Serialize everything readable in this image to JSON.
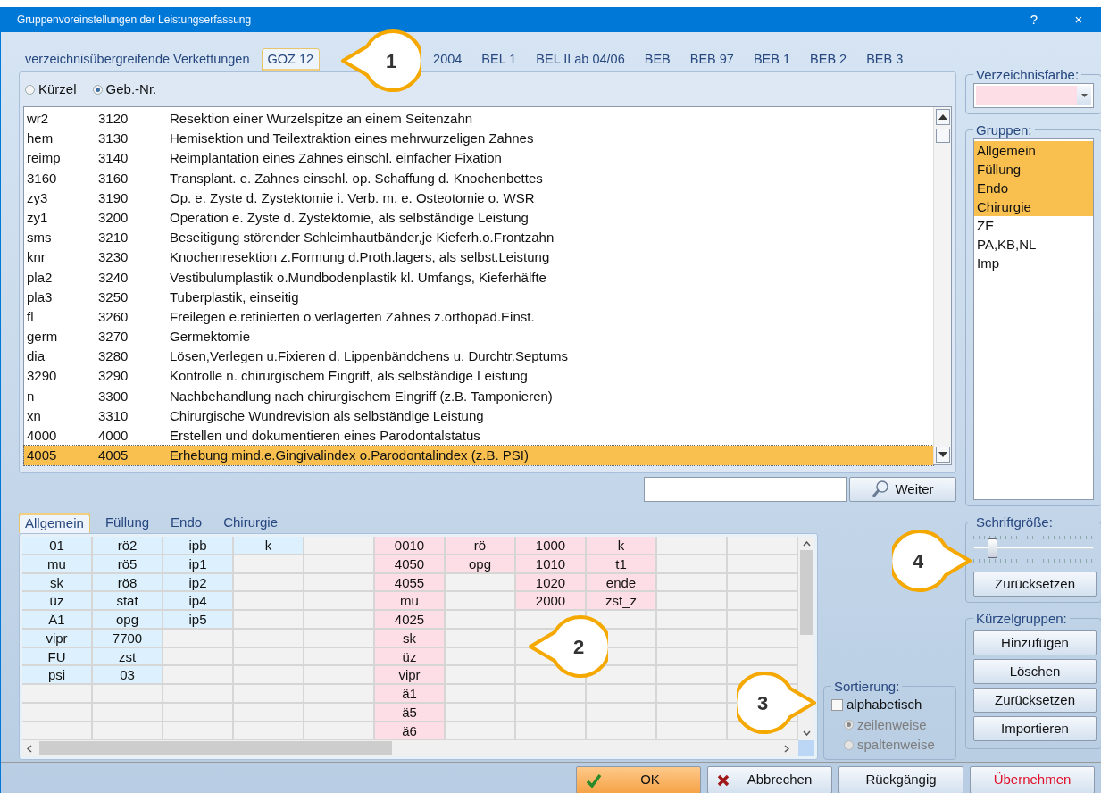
{
  "window": {
    "title": "Gruppenvoreinstellungen der Leistungserfassung",
    "help": "?",
    "close": "×"
  },
  "catalog_tabs": [
    {
      "label": "verzeichnisübergreifende Verkettungen",
      "selected": false
    },
    {
      "label": "GOZ 12",
      "selected": true
    },
    {
      "label": "2004",
      "selected": false
    },
    {
      "label": "BEL 1",
      "selected": false
    },
    {
      "label": "BEL II ab 04/06",
      "selected": false
    },
    {
      "label": "BEB",
      "selected": false
    },
    {
      "label": "BEB 97",
      "selected": false
    },
    {
      "label": "BEB 1",
      "selected": false
    },
    {
      "label": "BEB 2",
      "selected": false
    },
    {
      "label": "BEB 3",
      "selected": false
    }
  ],
  "sort_radios": [
    {
      "label": "Kürzel",
      "selected": false
    },
    {
      "label": "Geb.-Nr.",
      "selected": true
    }
  ],
  "services": [
    {
      "code": "wr2",
      "number": "3120",
      "description": "Resektion einer Wurzelspitze an einem Seitenzahn",
      "selected": false
    },
    {
      "code": "hem",
      "number": "3130",
      "description": "Hemisektion und Teilextraktion eines mehrwurzeligen Zahnes",
      "selected": false
    },
    {
      "code": "reimp",
      "number": "3140",
      "description": "Reimplantation eines Zahnes einschl. einfacher Fixation",
      "selected": false
    },
    {
      "code": "3160",
      "number": "3160",
      "description": "Transplant. e. Zahnes einschl. op. Schaffung d. Knochenbettes",
      "selected": false
    },
    {
      "code": "zy3",
      "number": "3190",
      "description": "Op. e. Zyste d. Zystektomie i. Verb. m. e. Osteotomie o. WSR",
      "selected": false
    },
    {
      "code": "zy1",
      "number": "3200",
      "description": "Operation e. Zyste d. Zystektomie, als selbständige Leistung",
      "selected": false
    },
    {
      "code": "sms",
      "number": "3210",
      "description": "Beseitigung störender Schleimhautbänder,je Kieferh.o.Frontzahn",
      "selected": false
    },
    {
      "code": "knr",
      "number": "3230",
      "description": "Knochenresektion z.Formung d.Proth.lagers, als selbst.Leistung",
      "selected": false
    },
    {
      "code": "pla2",
      "number": "3240",
      "description": "Vestibulumplastik o.Mundbodenplastik kl. Umfangs, Kieferhälfte",
      "selected": false
    },
    {
      "code": "pla3",
      "number": "3250",
      "description": "Tuberplastik, einseitig",
      "selected": false
    },
    {
      "code": "fl",
      "number": "3260",
      "description": "Freilegen e.retinierten o.verlagerten Zahnes z.orthopäd.Einst.",
      "selected": false
    },
    {
      "code": "germ",
      "number": "3270",
      "description": "Germektomie",
      "selected": false
    },
    {
      "code": "dia",
      "number": "3280",
      "description": "Lösen,Verlegen u.Fixieren d. Lippenbändchens u. Durchtr.Septums",
      "selected": false
    },
    {
      "code": "3290",
      "number": "3290",
      "description": "Kontrolle n. chirurgischem Eingriff, als selbständige Leistung",
      "selected": false
    },
    {
      "code": "n",
      "number": "3300",
      "description": "Nachbehandlung nach chirurgischem Eingriff (z.B. Tamponieren)",
      "selected": false
    },
    {
      "code": "xn",
      "number": "3310",
      "description": "Chirurgische Wundrevision  als selbständige Leistung",
      "selected": false
    },
    {
      "code": "4000",
      "number": "4000",
      "description": "Erstellen und dokumentieren eines Parodontalstatus",
      "selected": false
    },
    {
      "code": "4005",
      "number": "4005",
      "description": "Erhebung mind.e.Gingivalindex o.Parodontalindex (z.B. PSI)",
      "selected": true
    }
  ],
  "search_button": "Weiter",
  "group_tabs": [
    {
      "label": "Allgemein",
      "selected": true
    },
    {
      "label": "Füllung",
      "selected": false
    },
    {
      "label": "Endo",
      "selected": false
    },
    {
      "label": "Chirurgie",
      "selected": false
    }
  ],
  "grid_columns": [
    {
      "color": "#dcf1fd",
      "cells": [
        "01",
        "mu",
        "sk",
        "üz",
        "Ä1",
        "vipr",
        "FU",
        "psi"
      ]
    },
    {
      "color": "#dcf1fd",
      "cells": [
        "rö2",
        "rö5",
        "rö8",
        "stat",
        "opg",
        "7700",
        "zst",
        "03"
      ]
    },
    {
      "color": "#dcf1fd",
      "cells": [
        "ipb",
        "ip1",
        "ip2",
        "ip4",
        "ip5"
      ]
    },
    {
      "color": "#dcf1fd",
      "cells": [
        "k"
      ]
    },
    {},
    {
      "color": "#fddde6",
      "cells": [
        "0010",
        "4050",
        "4055",
        "mu",
        "4025",
        "sk",
        "üz",
        "vipr",
        "ä1",
        "ä5",
        "ä6"
      ]
    },
    {
      "color": "#fddde6",
      "cells": [
        "rö",
        "opg"
      ]
    },
    {
      "color": "#fddde6",
      "cells": [
        "1000",
        "1010",
        "1020",
        "2000"
      ]
    },
    {
      "color": "#fddde6",
      "cells": [
        "k",
        "t1",
        "ende",
        "zst_z"
      ]
    },
    {},
    {}
  ],
  "sorting": {
    "title": "Sortierung:",
    "alphabetic": {
      "label": "alphabetisch",
      "checked": false
    },
    "options": [
      {
        "label": "zeilenweise",
        "selected": true,
        "disabled": true
      },
      {
        "label": "spaltenweise",
        "selected": false,
        "disabled": true
      }
    ]
  },
  "catalog_color": {
    "title": "Verzeichnisfarbe:",
    "color": "#fddde6"
  },
  "groups": {
    "title": "Gruppen:",
    "items": [
      {
        "label": "Allgemein",
        "selected": true
      },
      {
        "label": "Füllung",
        "selected": true
      },
      {
        "label": "Endo",
        "selected": true
      },
      {
        "label": "Chirurgie",
        "selected": true
      },
      {
        "label": "ZE",
        "selected": false
      },
      {
        "label": "PA,KB,NL",
        "selected": false
      },
      {
        "label": "Imp",
        "selected": false
      }
    ]
  },
  "font_size": {
    "title": "Schriftgröße:",
    "level": 0.12,
    "reset": "Zurücksetzen"
  },
  "shortcut_groups": {
    "title": "Kürzelgruppen:",
    "buttons": [
      "Hinzufügen",
      "Löschen",
      "Zurücksetzen",
      "Importieren"
    ]
  },
  "footer_buttons": [
    {
      "label": "OK",
      "kind": "ok"
    },
    {
      "label": "Abbrechen",
      "kind": "cancel"
    },
    {
      "label": "Rückgängig",
      "kind": "plain"
    },
    {
      "label": "Übernehmen",
      "kind": "apply"
    }
  ],
  "callouts": [
    {
      "number": "1"
    },
    {
      "number": "2"
    },
    {
      "number": "3"
    },
    {
      "number": "4"
    }
  ]
}
